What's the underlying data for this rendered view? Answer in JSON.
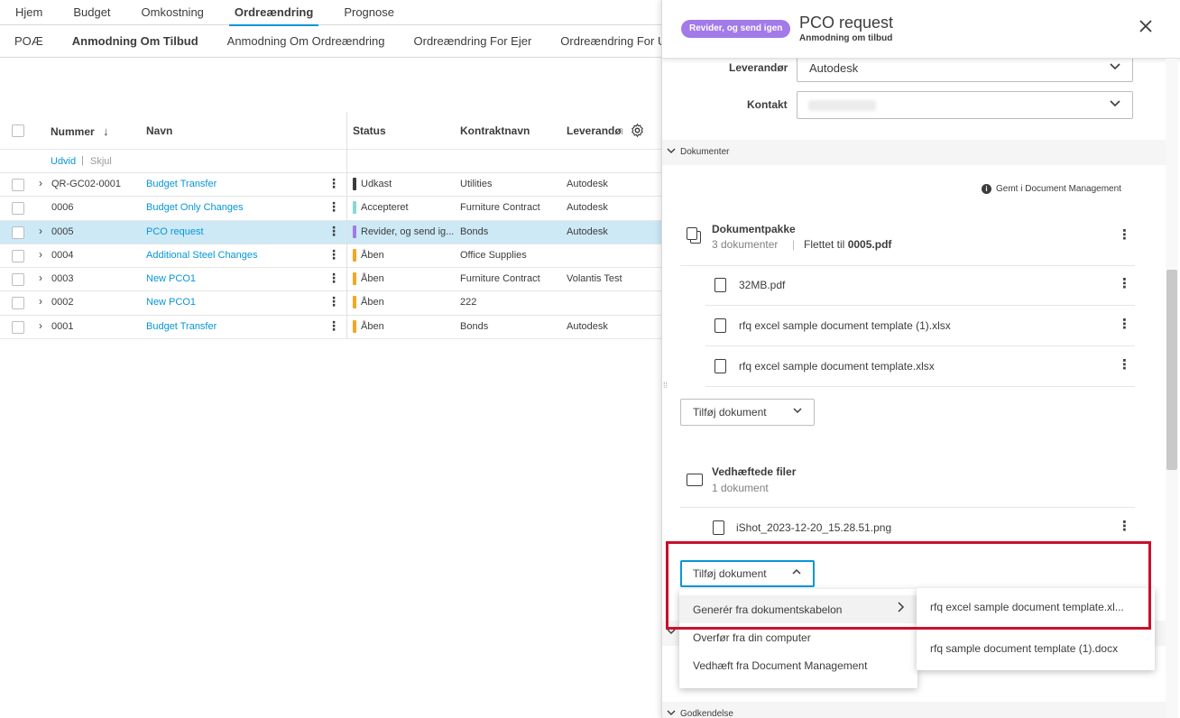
{
  "topnav": {
    "tabs": [
      "Hjem",
      "Budget",
      "Omkostning",
      "Ordreændring",
      "Prognose"
    ],
    "active": "Ordreændring"
  },
  "subnav": {
    "tabs": [
      "POÆ",
      "Anmodning Om Tilbud",
      "Anmodning Om Ordreændring",
      "Ordreændring For Ejer",
      "Ordreændring For Unde"
    ],
    "active": "Anmodning Om Tilbud"
  },
  "table": {
    "headers": {
      "number": "Nummer",
      "name": "Navn",
      "status": "Status",
      "contract": "Kontraktnavn",
      "vendor": "Leverandør"
    },
    "expand_label": "Udvid",
    "separator": "|",
    "collapse_label": "Skjul",
    "rows": [
      {
        "number": "QR-GC02-0001",
        "name": "Budget Transfer",
        "status": "Udkast",
        "status_color": "#3c3c3c",
        "contract": "Utilities",
        "vendor": "Autodesk",
        "expandable": true,
        "selected": false
      },
      {
        "number": "0006",
        "name": "Budget Only Changes",
        "status": "Accepteret",
        "status_color": "#87d9d0",
        "contract": "Furniture Contract",
        "vendor": "Autodesk",
        "expandable": false,
        "selected": false
      },
      {
        "number": "0005",
        "name": "PCO request",
        "status": "Revider, og send ig...",
        "status_color": "#a27ae9",
        "contract": "Bonds",
        "vendor": "Autodesk",
        "expandable": true,
        "selected": true
      },
      {
        "number": "0004",
        "name": "Additional Steel Changes",
        "status": "Åben",
        "status_color": "#f5a623",
        "contract": "Office Supplies",
        "vendor": "",
        "expandable": true,
        "selected": false
      },
      {
        "number": "0003",
        "name": "New PCO1",
        "status": "Åben",
        "status_color": "#f5a623",
        "contract": "Furniture Contract",
        "vendor": "Volantis Test",
        "expandable": true,
        "selected": false
      },
      {
        "number": "0002",
        "name": "New PCO1",
        "status": "Åben",
        "status_color": "#f5a623",
        "contract": "222",
        "vendor": "",
        "expandable": true,
        "selected": false
      },
      {
        "number": "0001",
        "name": "Budget Transfer",
        "status": "Åben",
        "status_color": "#f5a623",
        "contract": "Bonds",
        "vendor": "Autodesk",
        "expandable": true,
        "selected": false
      }
    ]
  },
  "panel": {
    "badge": "Revider, og send igen",
    "title": "PCO request",
    "subtitle": "Anmodning om tilbud",
    "vendor_label": "Leverandør",
    "vendor_value": "Autodesk",
    "contact_label": "Kontakt",
    "documents_section": "Dokumenter",
    "saved_in": "Gemt i Document Management",
    "package": {
      "title": "Dokumentpakke",
      "count": "3 dokumenter",
      "separator": "|",
      "merged_prefix": "Flettet til",
      "merged_file": "0005.pdf",
      "files": [
        "32MB.pdf",
        "rfq excel sample document template (1).xlsx",
        "rfq excel sample document template.xlsx"
      ]
    },
    "add_document_label": "Tilføj dokument",
    "attachments": {
      "title": "Vedhæftede filer",
      "count": "1 dokument",
      "files": [
        "iShot_2023-12-20_15.28.51.png"
      ]
    },
    "approval_section": "Godkendelse"
  },
  "menu": {
    "items": [
      "Generér fra dokumentskabelon",
      "Overfør fra din computer",
      "Vedhæft fra Document Management"
    ]
  },
  "submenu": {
    "items": [
      "rfq excel sample document template.xl...",
      "rfq sample document template (1).docx"
    ]
  },
  "colors": {
    "accent": "#0696d7",
    "badge": "#a27ae9",
    "highlight": "#c8102e",
    "selected_row": "#cde9f6"
  }
}
